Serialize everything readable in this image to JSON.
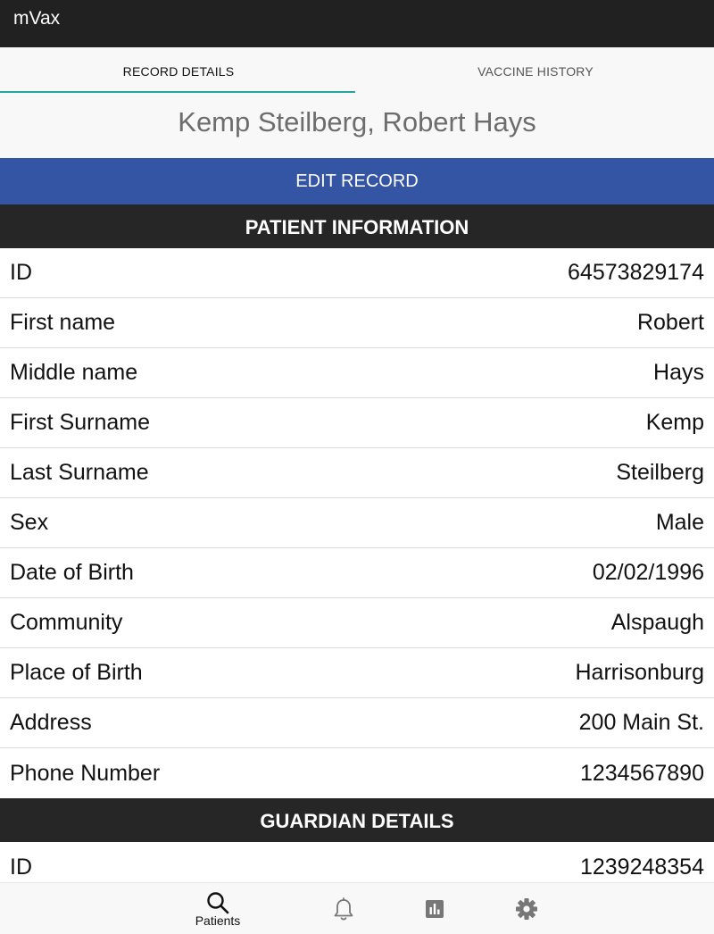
{
  "app": {
    "title": "mVax"
  },
  "tabs": [
    {
      "label": "RECORD DETAILS",
      "active": true
    },
    {
      "label": "VACCINE HISTORY",
      "active": false
    }
  ],
  "patient_name": "Kemp Steilberg, Robert Hays",
  "edit_button": "EDIT RECORD",
  "patient_section": {
    "title": "PATIENT INFORMATION",
    "rows": [
      {
        "label": "ID",
        "value": "64573829174"
      },
      {
        "label": "First name",
        "value": "Robert"
      },
      {
        "label": "Middle name",
        "value": "Hays"
      },
      {
        "label": "First Surname",
        "value": "Kemp"
      },
      {
        "label": "Last Surname",
        "value": "Steilberg"
      },
      {
        "label": "Sex",
        "value": "Male"
      },
      {
        "label": "Date of Birth",
        "value": "02/02/1996"
      },
      {
        "label": "Community",
        "value": "Alspaugh"
      },
      {
        "label": "Place of Birth",
        "value": "Harrisonburg"
      },
      {
        "label": "Address",
        "value": "200 Main St."
      },
      {
        "label": "Phone Number",
        "value": "1234567890"
      }
    ]
  },
  "guardian_section": {
    "title": "GUARDIAN DETAILS",
    "rows": [
      {
        "label": "ID",
        "value": "1239248354"
      }
    ]
  },
  "bottom_nav": {
    "items": [
      {
        "icon": "search-icon",
        "label": "Patients"
      },
      {
        "icon": "bell-icon",
        "label": ""
      },
      {
        "icon": "bar-chart-icon",
        "label": ""
      },
      {
        "icon": "gear-icon",
        "label": ""
      }
    ]
  },
  "colors": {
    "title_bar": "#212121",
    "tab_indicator": "#26a69a",
    "edit_button": "#3454a4",
    "section_header": "#262626"
  }
}
